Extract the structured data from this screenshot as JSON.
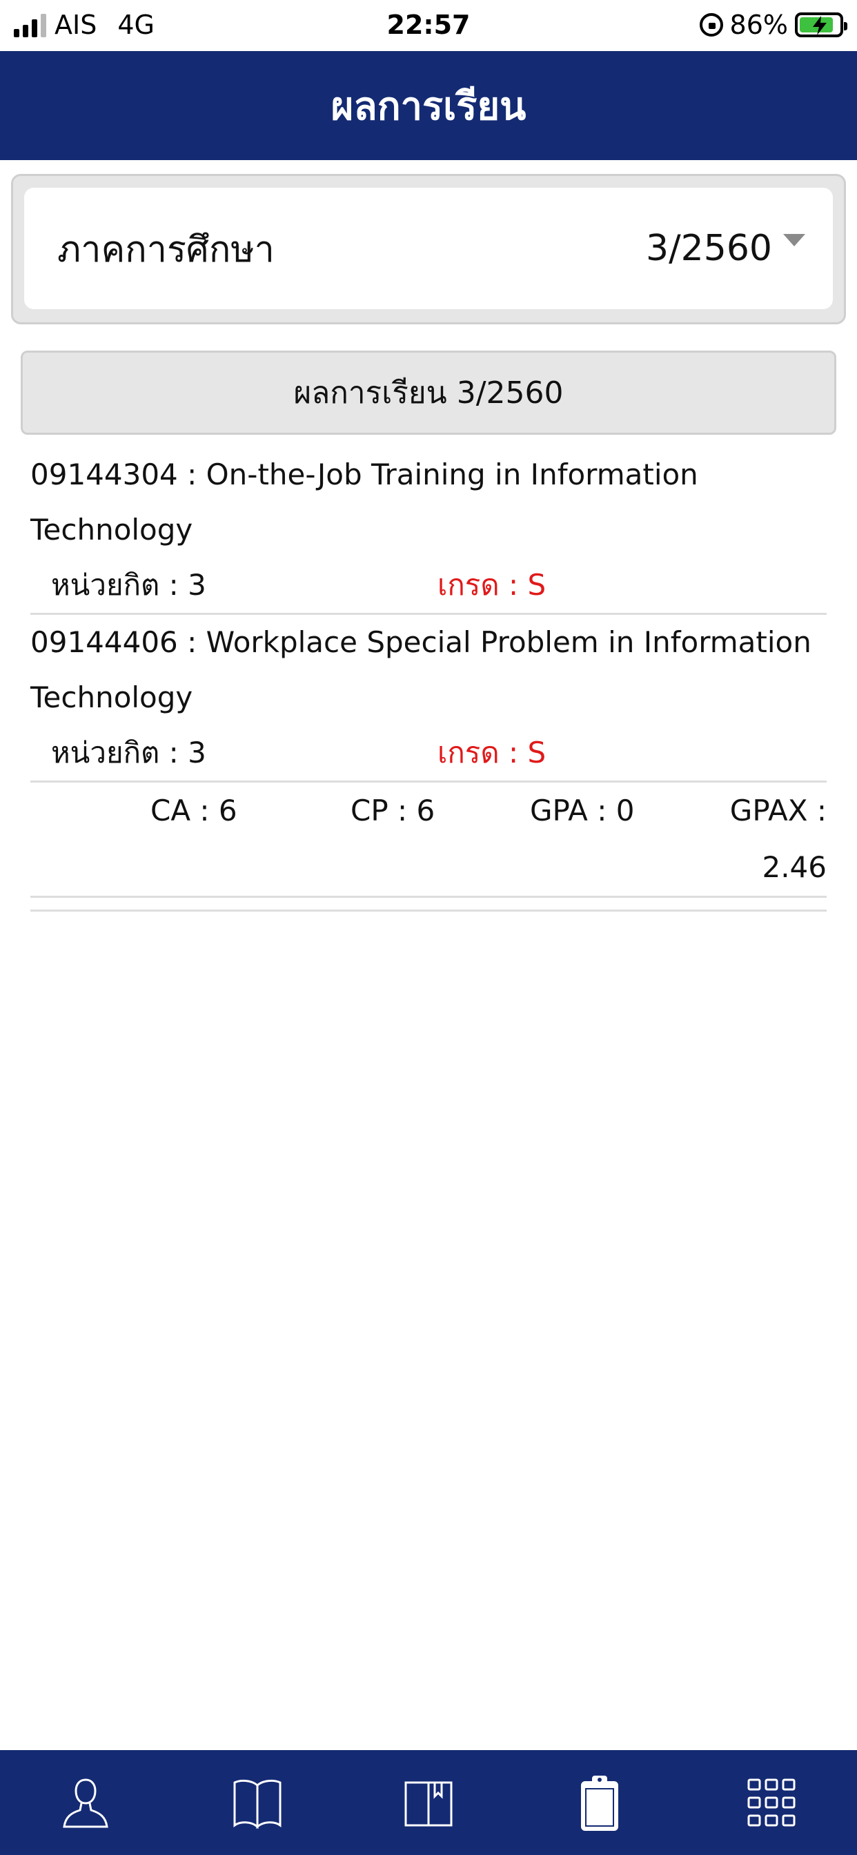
{
  "status_bar": {
    "carrier": "AIS",
    "network": "4G",
    "time": "22:57",
    "battery": "86%"
  },
  "header": {
    "title": "ผลการเรียน"
  },
  "semester": {
    "label": "ภาคการศึกษา",
    "value": "3/2560"
  },
  "section": {
    "title": "ผลการเรียน 3/2560"
  },
  "courses": [
    {
      "title": "09144304 : On-the-Job Training in Information Technology",
      "credit": "หน่วยกิต : 3",
      "grade": "เกรด : S"
    },
    {
      "title": "09144406 : Workplace Special Problem in Information Technology",
      "credit": "หน่วยกิต : 3",
      "grade": "เกรด : S"
    }
  ],
  "summary": {
    "ca": "CA : 6",
    "cp": "CP : 6",
    "gpa": "GPA : 0",
    "gpax": "GPAX : 2.46"
  },
  "colors": {
    "header_bg": "#142a73",
    "grade_text": "#e01a1a",
    "bar_bg": "#e6e6e6"
  },
  "bottom_nav": [
    {
      "icon": "profile-icon"
    },
    {
      "icon": "open-book-icon"
    },
    {
      "icon": "bookmark-book-icon"
    },
    {
      "icon": "clipboard-icon",
      "active": true
    },
    {
      "icon": "grid-menu-icon"
    }
  ]
}
